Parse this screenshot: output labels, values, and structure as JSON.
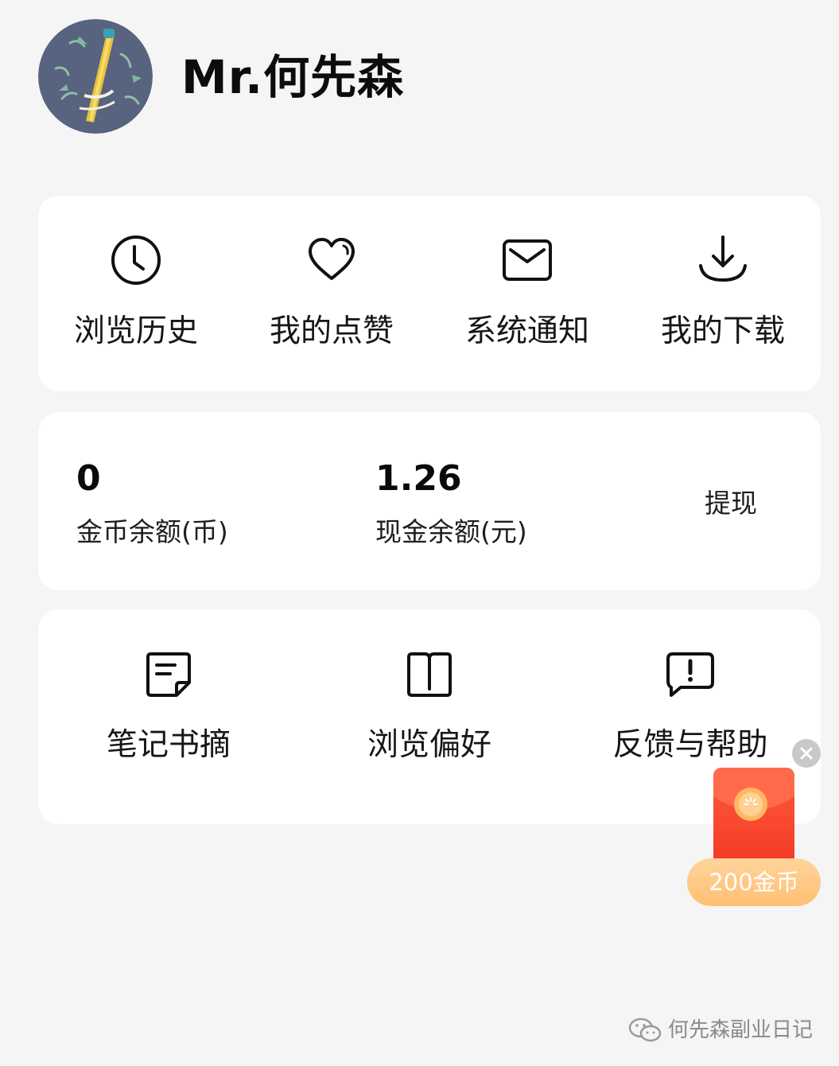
{
  "profile": {
    "username": "Mr.何先森",
    "avatar_icon": "sword-bamboo-avatar"
  },
  "quick_menu": [
    {
      "label": "浏览历史",
      "icon": "clock-icon"
    },
    {
      "label": "我的点赞",
      "icon": "heart-icon"
    },
    {
      "label": "系统通知",
      "icon": "mail-icon"
    },
    {
      "label": "我的下载",
      "icon": "download-icon"
    }
  ],
  "balance": {
    "coins_value": "0",
    "coins_label": "金币余额(币)",
    "cash_value": "1.26",
    "cash_label": "现金余额(元)",
    "withdraw_label": "提现"
  },
  "tools": [
    {
      "label": "笔记书摘",
      "icon": "note-icon"
    },
    {
      "label": "浏览偏好",
      "icon": "book-icon"
    },
    {
      "label": "反馈与帮助",
      "icon": "feedback-icon"
    }
  ],
  "red_packet": {
    "reward_label": "200金币",
    "close_icon": "close-icon"
  },
  "watermark": {
    "text": "何先森副业日记",
    "icon": "wechat-icon"
  },
  "colors": {
    "background": "#f5f5f5",
    "card": "#ffffff",
    "packet_red": "#f33a24",
    "badge_orange": "#ffbf73"
  }
}
